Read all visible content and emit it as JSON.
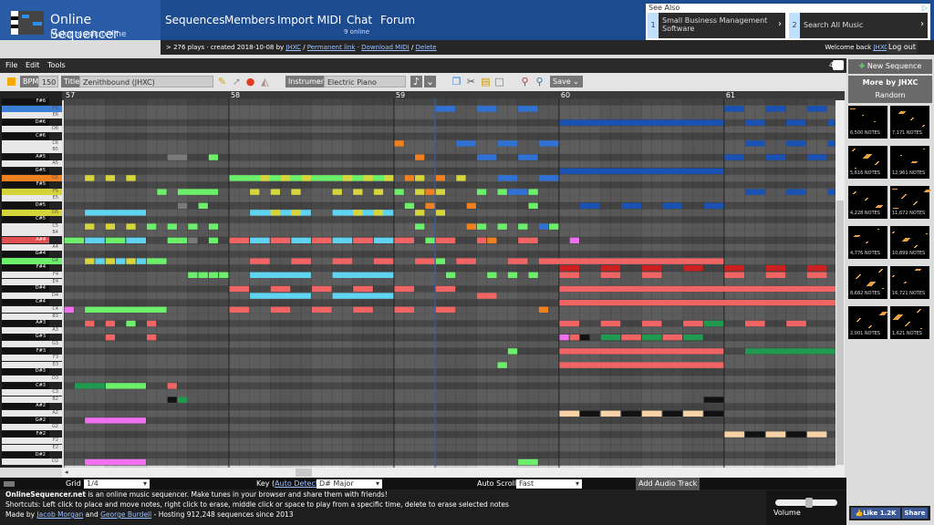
{
  "header": {
    "logo_title": "Online Sequencer",
    "logo_subtitle": "Make music online",
    "nav": [
      "Sequences",
      "Members",
      "Import MIDI",
      "Chat",
      "Forum"
    ],
    "chat_online": "9 online"
  },
  "info": {
    "prefix": "> 276 plays · created 2018-10-08 by",
    "user": "JHXC",
    "sep1": "/",
    "permalink": "Permanent link",
    "sep2": "·",
    "download": "Download MIDI",
    "sep3": "/",
    "delete": "Delete"
  },
  "ad": {
    "see_also": "See Also",
    "items": [
      {
        "num": "1",
        "text": "Small Business Management Software"
      },
      {
        "num": "2",
        "text": "Search All Music"
      }
    ]
  },
  "account": {
    "welcome": "Welcome back",
    "user": "JHXC",
    "logout": "Log out"
  },
  "menu": [
    "File",
    "Edit",
    "Tools"
  ],
  "chat_count": "4",
  "toolbar": {
    "bpm_label": "BPM",
    "bpm": "150",
    "title_label": "Title",
    "title": "Zenithbound (JHXC)",
    "instrument_label": "Instrument",
    "instrument": "Electric Piano",
    "save": "Save"
  },
  "measures": [
    "57",
    "58",
    "59",
    "60",
    "61"
  ],
  "keys": [
    "F#6",
    "F6",
    "E6",
    "D#6",
    "D6",
    "C#6",
    "C6",
    "B5",
    "A#5",
    "A5",
    "G#5",
    "G5",
    "F#5",
    "F5",
    "E5",
    "D#5",
    "D5",
    "C#5",
    "C5",
    "B4",
    "A#4",
    "A4",
    "G#4",
    "G4",
    "F#4",
    "F4",
    "E4",
    "D#4",
    "D4",
    "C#4",
    "C4",
    "B3",
    "A#3",
    "A3",
    "G#3",
    "G3",
    "F#3",
    "F3",
    "E3",
    "D#3",
    "D3",
    "C#3",
    "C3",
    "B2",
    "A#2",
    "A2",
    "G#2",
    "G2",
    "F#2",
    "F2",
    "E2",
    "D#2",
    "D2"
  ],
  "highlighted_keys": {
    "F6": "#3a7fd5",
    "G5": "#f08020",
    "F5": "#d4d43a",
    "D5": "#d4d43a",
    "A#4": "#e05050",
    "G4": "#6cf06c"
  },
  "colors": {
    "Y": "#d6d63c",
    "G": "#6cf06c",
    "C": "#5fd3f0",
    "R": "#f06464",
    "O": "#f08020",
    "B": "#2f72d4",
    "D": "#1a52b3",
    "P": "#f070f0",
    "K": "#1f9a50",
    "E": "#f6d2a6",
    "X": "#111111",
    "M": "#cc2020",
    "A": "#7a7a7a"
  },
  "notes": [
    [
      1,
      36,
      2,
      "B"
    ],
    [
      1,
      40,
      2,
      "B"
    ],
    [
      1,
      44,
      2,
      "B"
    ],
    [
      1,
      64,
      2,
      "D"
    ],
    [
      1,
      68,
      2,
      "D"
    ],
    [
      1,
      72,
      2,
      "D"
    ],
    [
      3,
      48,
      16,
      "D"
    ],
    [
      3,
      66,
      2,
      "D"
    ],
    [
      3,
      70,
      2,
      "D"
    ],
    [
      3,
      74,
      1,
      "D"
    ],
    [
      6,
      32,
      1,
      "O"
    ],
    [
      6,
      38,
      2,
      "B"
    ],
    [
      6,
      42,
      2,
      "B"
    ],
    [
      6,
      46,
      2,
      "B"
    ],
    [
      6,
      66,
      2,
      "D"
    ],
    [
      6,
      70,
      2,
      "D"
    ],
    [
      6,
      74,
      1,
      "D"
    ],
    [
      8,
      10,
      2,
      "A"
    ],
    [
      8,
      14,
      1,
      "G"
    ],
    [
      8,
      34,
      1,
      "O"
    ],
    [
      8,
      40,
      2,
      "B"
    ],
    [
      8,
      44,
      2,
      "B"
    ],
    [
      8,
      64,
      2,
      "D"
    ],
    [
      8,
      68,
      2,
      "D"
    ],
    [
      8,
      72,
      2,
      "D"
    ],
    [
      10,
      48,
      16,
      "D"
    ],
    [
      11,
      2,
      1,
      "Y"
    ],
    [
      11,
      4,
      1,
      "Y"
    ],
    [
      11,
      6,
      1,
      "Y"
    ],
    [
      11,
      16,
      16,
      "G"
    ],
    [
      11,
      19,
      1,
      "Y"
    ],
    [
      11,
      21,
      1,
      "Y"
    ],
    [
      11,
      23,
      1,
      "Y"
    ],
    [
      11,
      27,
      1,
      "Y"
    ],
    [
      11,
      29,
      1,
      "Y"
    ],
    [
      11,
      31,
      1,
      "Y"
    ],
    [
      11,
      33,
      1,
      "O"
    ],
    [
      11,
      34,
      1,
      "Y"
    ],
    [
      11,
      36,
      1,
      "O"
    ],
    [
      11,
      38,
      1,
      "Y"
    ],
    [
      11,
      42,
      2,
      "B"
    ],
    [
      11,
      46,
      2,
      "B"
    ],
    [
      13,
      9,
      1,
      "G"
    ],
    [
      13,
      11,
      4,
      "G"
    ],
    [
      13,
      18,
      1,
      "Y"
    ],
    [
      13,
      20,
      1,
      "Y"
    ],
    [
      13,
      22,
      1,
      "Y"
    ],
    [
      13,
      26,
      1,
      "Y"
    ],
    [
      13,
      28,
      1,
      "Y"
    ],
    [
      13,
      30,
      1,
      "Y"
    ],
    [
      13,
      32,
      1,
      "G"
    ],
    [
      13,
      34,
      1,
      "Y"
    ],
    [
      13,
      35,
      1,
      "O"
    ],
    [
      13,
      36,
      1,
      "Y"
    ],
    [
      13,
      40,
      1,
      "G"
    ],
    [
      13,
      42,
      1,
      "G"
    ],
    [
      13,
      43,
      2,
      "B"
    ],
    [
      13,
      45,
      1,
      "G"
    ],
    [
      13,
      66,
      2,
      "D"
    ],
    [
      13,
      70,
      2,
      "D"
    ],
    [
      13,
      74,
      1,
      "D"
    ],
    [
      15,
      11,
      1,
      "A"
    ],
    [
      15,
      13,
      1,
      "G"
    ],
    [
      15,
      33,
      1,
      "G"
    ],
    [
      15,
      35,
      1,
      "O"
    ],
    [
      15,
      39,
      1,
      "O"
    ],
    [
      15,
      45,
      1,
      "G"
    ],
    [
      15,
      50,
      2,
      "D"
    ],
    [
      15,
      54,
      2,
      "D"
    ],
    [
      15,
      58,
      2,
      "D"
    ],
    [
      15,
      62,
      2,
      "D"
    ],
    [
      16,
      2,
      6,
      "C"
    ],
    [
      16,
      18,
      6,
      "C"
    ],
    [
      16,
      20,
      1,
      "Y"
    ],
    [
      16,
      22,
      1,
      "Y"
    ],
    [
      16,
      26,
      6,
      "C"
    ],
    [
      16,
      28,
      1,
      "Y"
    ],
    [
      16,
      30,
      1,
      "Y"
    ],
    [
      16,
      34,
      1,
      "Y"
    ],
    [
      16,
      36,
      1,
      "Y"
    ],
    [
      18,
      2,
      1,
      "Y"
    ],
    [
      18,
      4,
      1,
      "Y"
    ],
    [
      18,
      6,
      1,
      "Y"
    ],
    [
      18,
      8,
      1,
      "G"
    ],
    [
      18,
      10,
      1,
      "G"
    ],
    [
      18,
      12,
      1,
      "G"
    ],
    [
      18,
      14,
      1,
      "G"
    ],
    [
      18,
      34,
      1,
      "G"
    ],
    [
      18,
      39,
      1,
      "O"
    ],
    [
      18,
      40,
      1,
      "G"
    ],
    [
      18,
      42,
      1,
      "G"
    ],
    [
      18,
      44,
      1,
      "G"
    ],
    [
      18,
      46,
      1,
      "B"
    ],
    [
      18,
      47,
      1,
      "G"
    ],
    [
      20,
      0,
      2,
      "G"
    ],
    [
      20,
      2,
      2,
      "C"
    ],
    [
      20,
      4,
      2,
      "G"
    ],
    [
      20,
      6,
      2,
      "C"
    ],
    [
      20,
      10,
      2,
      "G"
    ],
    [
      20,
      12,
      1,
      "A"
    ],
    [
      20,
      14,
      1,
      "G"
    ],
    [
      20,
      16,
      2,
      "R"
    ],
    [
      20,
      18,
      2,
      "C"
    ],
    [
      20,
      20,
      2,
      "R"
    ],
    [
      20,
      22,
      2,
      "C"
    ],
    [
      20,
      24,
      2,
      "R"
    ],
    [
      20,
      26,
      2,
      "C"
    ],
    [
      20,
      28,
      2,
      "R"
    ],
    [
      20,
      30,
      2,
      "C"
    ],
    [
      20,
      32,
      2,
      "R"
    ],
    [
      20,
      35,
      1,
      "G"
    ],
    [
      20,
      36,
      2,
      "R"
    ],
    [
      20,
      40,
      1,
      "R"
    ],
    [
      20,
      41,
      1,
      "O"
    ],
    [
      20,
      44,
      2,
      "R"
    ],
    [
      20,
      49,
      1,
      "P"
    ],
    [
      23,
      2,
      1,
      "Y"
    ],
    [
      23,
      3,
      1,
      "C"
    ],
    [
      23,
      4,
      1,
      "Y"
    ],
    [
      23,
      5,
      1,
      "C"
    ],
    [
      23,
      6,
      1,
      "Y"
    ],
    [
      23,
      7,
      1,
      "C"
    ],
    [
      23,
      8,
      2,
      "G"
    ],
    [
      23,
      18,
      2,
      "R"
    ],
    [
      23,
      22,
      2,
      "R"
    ],
    [
      23,
      26,
      2,
      "R"
    ],
    [
      23,
      30,
      2,
      "R"
    ],
    [
      23,
      34,
      2,
      "R"
    ],
    [
      23,
      36,
      1,
      "G"
    ],
    [
      23,
      38,
      2,
      "R"
    ],
    [
      23,
      43,
      2,
      "R"
    ],
    [
      23,
      46,
      18,
      "R"
    ],
    [
      24,
      48,
      2,
      "M"
    ],
    [
      24,
      52,
      2,
      "M"
    ],
    [
      24,
      56,
      2,
      "M"
    ],
    [
      24,
      60,
      2,
      "M"
    ],
    [
      24,
      64,
      2,
      "M"
    ],
    [
      24,
      68,
      2,
      "M"
    ],
    [
      24,
      72,
      2,
      "M"
    ],
    [
      25,
      12,
      1,
      "G"
    ],
    [
      25,
      13,
      1,
      "G"
    ],
    [
      25,
      14,
      1,
      "G"
    ],
    [
      25,
      15,
      1,
      "G"
    ],
    [
      25,
      18,
      6,
      "C"
    ],
    [
      25,
      26,
      6,
      "C"
    ],
    [
      25,
      37,
      1,
      "G"
    ],
    [
      25,
      41,
      1,
      "G"
    ],
    [
      25,
      43,
      1,
      "G"
    ],
    [
      25,
      45,
      1,
      "G"
    ],
    [
      25,
      48,
      2,
      "R"
    ],
    [
      25,
      52,
      2,
      "R"
    ],
    [
      25,
      56,
      2,
      "R"
    ],
    [
      25,
      64,
      2,
      "R"
    ],
    [
      25,
      68,
      2,
      "R"
    ],
    [
      25,
      72,
      2,
      "R"
    ],
    [
      27,
      16,
      2,
      "R"
    ],
    [
      27,
      20,
      2,
      "R"
    ],
    [
      27,
      24,
      2,
      "R"
    ],
    [
      27,
      28,
      2,
      "R"
    ],
    [
      27,
      32,
      2,
      "R"
    ],
    [
      27,
      36,
      2,
      "R"
    ],
    [
      27,
      48,
      27,
      "R"
    ],
    [
      28,
      18,
      6,
      "C"
    ],
    [
      28,
      26,
      6,
      "C"
    ],
    [
      28,
      40,
      2,
      "R"
    ],
    [
      29,
      48,
      27,
      "R"
    ],
    [
      30,
      0,
      1,
      "P"
    ],
    [
      30,
      2,
      8,
      "G"
    ],
    [
      30,
      16,
      2,
      "R"
    ],
    [
      30,
      20,
      2,
      "R"
    ],
    [
      30,
      24,
      2,
      "R"
    ],
    [
      30,
      28,
      2,
      "R"
    ],
    [
      30,
      32,
      2,
      "R"
    ],
    [
      30,
      36,
      2,
      "R"
    ],
    [
      30,
      46,
      1,
      "O"
    ],
    [
      32,
      2,
      1,
      "R"
    ],
    [
      32,
      4,
      1,
      "R"
    ],
    [
      32,
      6,
      1,
      "G"
    ],
    [
      32,
      8,
      1,
      "R"
    ],
    [
      32,
      48,
      2,
      "R"
    ],
    [
      32,
      52,
      2,
      "R"
    ],
    [
      32,
      56,
      2,
      "R"
    ],
    [
      32,
      60,
      2,
      "R"
    ],
    [
      32,
      62,
      2,
      "K"
    ],
    [
      32,
      66,
      2,
      "R"
    ],
    [
      32,
      70,
      2,
      "R"
    ],
    [
      34,
      4,
      1,
      "R"
    ],
    [
      34,
      8,
      1,
      "R"
    ],
    [
      34,
      48,
      1,
      "P"
    ],
    [
      34,
      49,
      1,
      "R"
    ],
    [
      34,
      50,
      1,
      "X"
    ],
    [
      34,
      52,
      2,
      "K"
    ],
    [
      34,
      54,
      2,
      "R"
    ],
    [
      34,
      56,
      2,
      "K"
    ],
    [
      34,
      58,
      2,
      "R"
    ],
    [
      34,
      60,
      2,
      "K"
    ],
    [
      36,
      43,
      1,
      "G"
    ],
    [
      36,
      48,
      16,
      "R"
    ],
    [
      36,
      66,
      9,
      "K"
    ],
    [
      38,
      42,
      1,
      "G"
    ],
    [
      38,
      48,
      16,
      "R"
    ],
    [
      41,
      1,
      3,
      "K"
    ],
    [
      41,
      4,
      4,
      "G"
    ],
    [
      41,
      10,
      1,
      "R"
    ],
    [
      43,
      10,
      1,
      "X"
    ],
    [
      43,
      11,
      1,
      "K"
    ],
    [
      43,
      62,
      2,
      "X"
    ],
    [
      45,
      48,
      2,
      "E"
    ],
    [
      45,
      50,
      2,
      "X"
    ],
    [
      45,
      52,
      2,
      "E"
    ],
    [
      45,
      54,
      2,
      "X"
    ],
    [
      45,
      56,
      2,
      "E"
    ],
    [
      45,
      58,
      2,
      "X"
    ],
    [
      45,
      60,
      2,
      "E"
    ],
    [
      45,
      62,
      2,
      "X"
    ],
    [
      46,
      2,
      6,
      "P"
    ],
    [
      48,
      64,
      2,
      "E"
    ],
    [
      48,
      66,
      2,
      "X"
    ],
    [
      48,
      68,
      2,
      "E"
    ],
    [
      48,
      70,
      2,
      "X"
    ],
    [
      48,
      72,
      2,
      "E"
    ],
    [
      52,
      2,
      6,
      "P"
    ],
    [
      52,
      44,
      2,
      "G"
    ]
  ],
  "playhead_step": 36,
  "bottom": {
    "grid_label": "Grid",
    "grid": "1/4",
    "key_label": "Key (",
    "auto_detect": "Auto Detect",
    "key_close": "):",
    "key": "D# Major",
    "autoscroll_label": "Auto Scroll",
    "autoscroll": "Fast",
    "add_audio": "Add Audio Track",
    "line1_bold": "OnlineSequencer.net",
    "line1": " is an online music sequencer. Make tunes in your browser and share them with friends!",
    "line2": "Shortcuts: Left click to place and move notes, right click to erase, middle click or space to play from a specific time, delete to erase selected notes",
    "line3a": "Made by ",
    "author1": "Jacob Morgan",
    "line3b": " and ",
    "author2": "George Burdell",
    "line3c": " - Hosting 912,248 sequences since 2013",
    "volume_label": "Volume",
    "volume": 0.55
  },
  "side": {
    "new_sequence": "New Sequence",
    "more_by": "More by JHXC",
    "random": "Random",
    "thumbs": [
      "6,500 NOTES",
      "7,171 NOTES",
      "5,616 NOTES",
      "12,961 NOTES",
      "4,228 NOTES",
      "11,672 NOTES",
      "4,776 NOTES",
      "10,899 NOTES",
      "8,682 NOTES",
      "16,721 NOTES",
      "2,001 NOTES",
      "1,621 NOTES"
    ],
    "like": "Like 1.2K",
    "share": "Share"
  }
}
